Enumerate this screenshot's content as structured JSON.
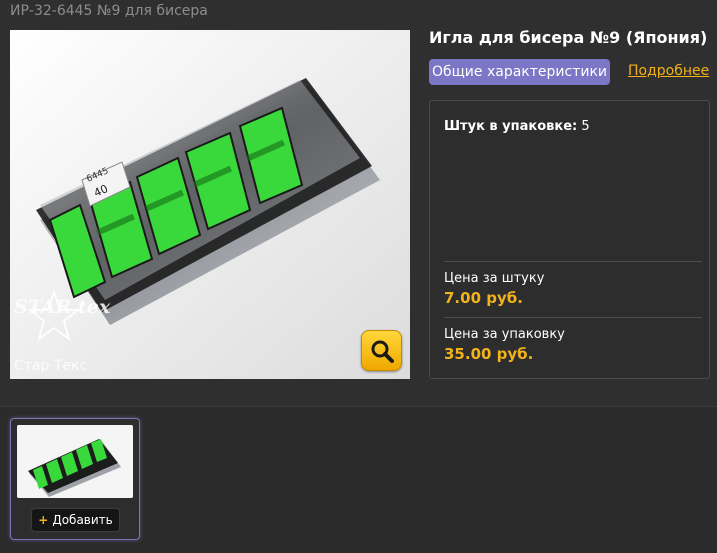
{
  "header": {
    "article": "ИР-32-6445 №9 для бисера"
  },
  "product": {
    "title": "Игла для бисера №9 (Япония)",
    "image": {
      "pack_labels": [
        "6445",
        "40"
      ],
      "brand_mark": "STAR tex",
      "brand_caption": "Стар Текс"
    }
  },
  "tabs": {
    "active": "Общие характеристики",
    "more": "Подробнее"
  },
  "specs": {
    "qty_label": "Штук в упаковке:",
    "qty_value": "5",
    "unit_price_label": "Цена за штуку",
    "unit_price": "7.00 руб.",
    "pack_price_label": "Цена за упаковку",
    "pack_price": "35.00 руб."
  },
  "thumb": {
    "add_label": "Добавить"
  },
  "colors": {
    "accent": "#f2b21b",
    "tab": "#7b77c6",
    "background": "#2f2f2f"
  },
  "icons": {
    "zoom": "magnifier-icon",
    "add": "plus-icon"
  }
}
